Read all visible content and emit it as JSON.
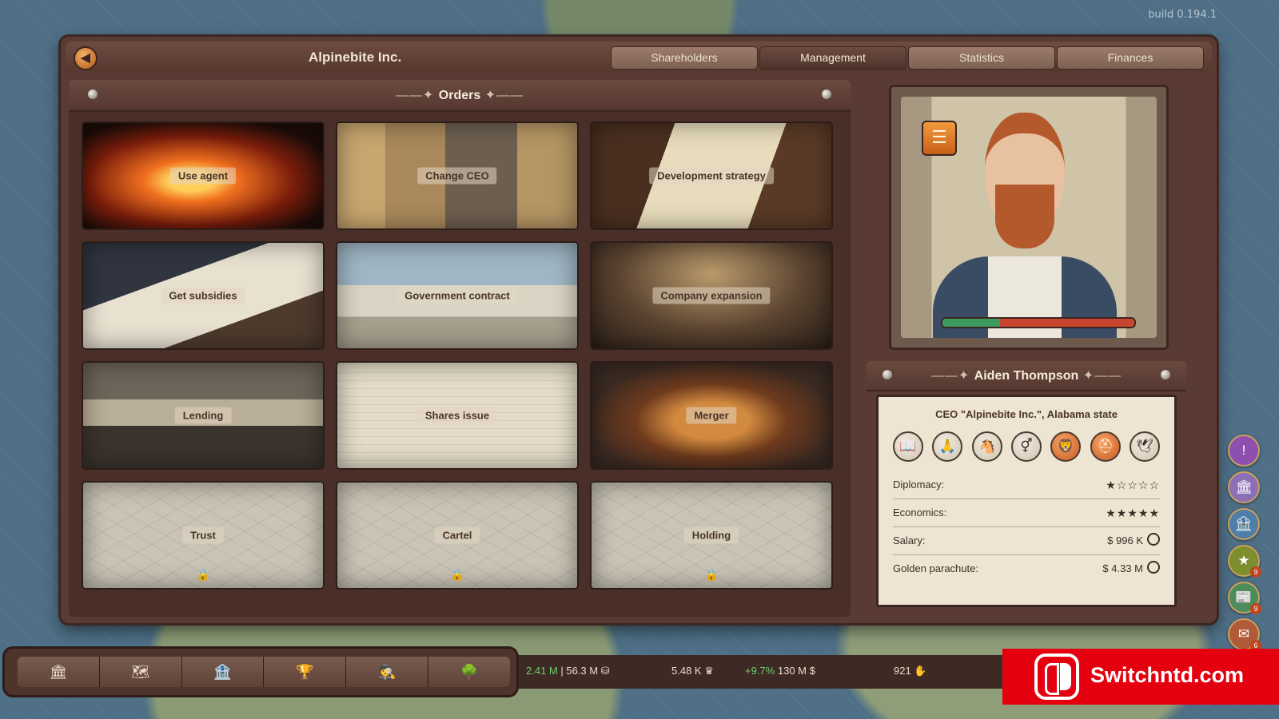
{
  "build": "build 0.194.1",
  "window": {
    "company_name": "Alpinebite Inc.",
    "tabs": [
      "Shareholders",
      "Management",
      "Statistics",
      "Finances"
    ],
    "active_tab": "Management"
  },
  "orders": {
    "title": "Orders",
    "cards": [
      {
        "label": "Use agent",
        "locked": false
      },
      {
        "label": "Change CEO",
        "locked": false
      },
      {
        "label": "Development strategy",
        "locked": false
      },
      {
        "label": "Get subsidies",
        "locked": false
      },
      {
        "label": "Government contract",
        "locked": false
      },
      {
        "label": "Company expansion",
        "locked": false
      },
      {
        "label": "Lending",
        "locked": false
      },
      {
        "label": "Shares issue",
        "locked": false
      },
      {
        "label": "Merger",
        "locked": false
      },
      {
        "label": "Trust",
        "locked": true
      },
      {
        "label": "Cartel",
        "locked": true
      },
      {
        "label": "Holding",
        "locked": true
      }
    ]
  },
  "ceo": {
    "name": "Aiden Thompson",
    "role": "CEO \"Alpinebite Inc.\", Alabama state",
    "mood_fraction": 0.3,
    "traits": [
      "book-icon",
      "praying-hands-icon",
      "donkey-icon",
      "gender-icon",
      "lion-icon",
      "spartan-helmet-icon",
      "dove-icon"
    ],
    "stats": {
      "diplomacy_label": "Diplomacy:",
      "diplomacy_stars": 1,
      "economics_label": "Economics:",
      "economics_stars": 5,
      "salary_label": "Salary:",
      "salary_value": "$ 996 K",
      "parachute_label": "Golden parachute:",
      "parachute_value": "$ 4.33 M"
    }
  },
  "side_buttons": [
    {
      "icon": "exclamation-icon",
      "badge": "",
      "color": "#8d4fb0"
    },
    {
      "icon": "capitol-icon",
      "badge": "",
      "color": "#8d6fb5"
    },
    {
      "icon": "building-icon",
      "badge": "",
      "color": "#4f7ea8"
    },
    {
      "icon": "star-icon",
      "badge": "9",
      "color": "#7c8e2e"
    },
    {
      "icon": "newspaper-icon",
      "badge": "9",
      "color": "#4c8b5a"
    },
    {
      "icon": "envelope-icon",
      "badge": "6",
      "color": "#b05a3a"
    }
  ],
  "bottom": {
    "nav": [
      "government-icon",
      "map-icon",
      "bank-icon",
      "trophy-icon",
      "spy-icon",
      "tree-icon"
    ],
    "money_a": "2.41 M",
    "money_b": "56.3 M",
    "crown_value": "5.48 K",
    "growth": "+9.7%",
    "budget": "130 M",
    "votes": "921"
  },
  "watermark": "Switchntd.com"
}
